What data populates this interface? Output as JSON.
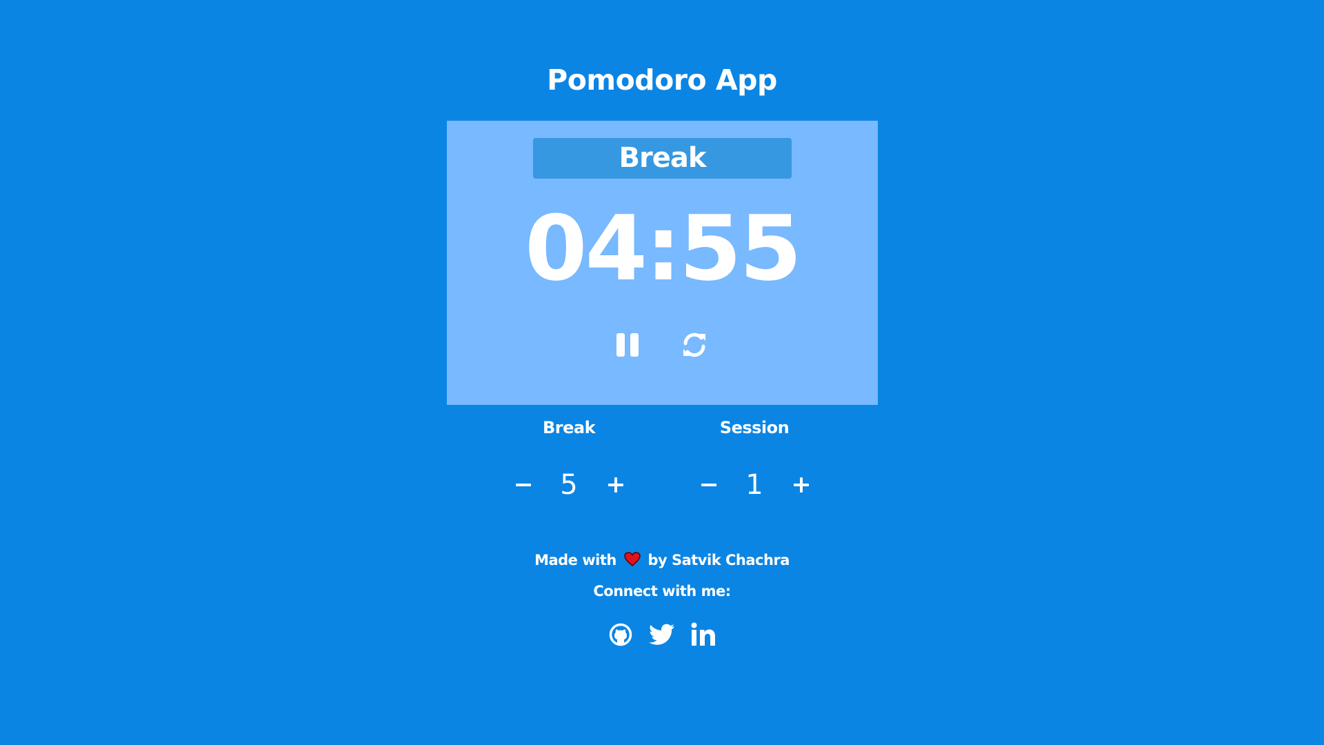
{
  "app": {
    "title": "Pomodoro App"
  },
  "timer": {
    "mode": "Break",
    "time": "04:55",
    "controls": {
      "pause_icon": "pause-icon",
      "reset_icon": "refresh-icon"
    }
  },
  "settings": {
    "break": {
      "label": "Break",
      "value": "5",
      "decrement_icon": "minus-icon",
      "increment_icon": "plus-icon"
    },
    "session": {
      "label": "Session",
      "value": "1",
      "decrement_icon": "minus-icon",
      "increment_icon": "plus-icon"
    }
  },
  "footer": {
    "made_with_prefix": "Made with",
    "made_with_suffix": "by Satvik Chachra",
    "heart_icon": "heart-icon",
    "connect": "Connect with me:",
    "social": [
      "github-icon",
      "twitter-icon",
      "linkedin-icon"
    ]
  },
  "colors": {
    "background": "#0b85e4",
    "card": "#78b9ff",
    "mode_label_bg": "#3698e0",
    "text": "#ffffff",
    "heart": "#e0121f"
  }
}
